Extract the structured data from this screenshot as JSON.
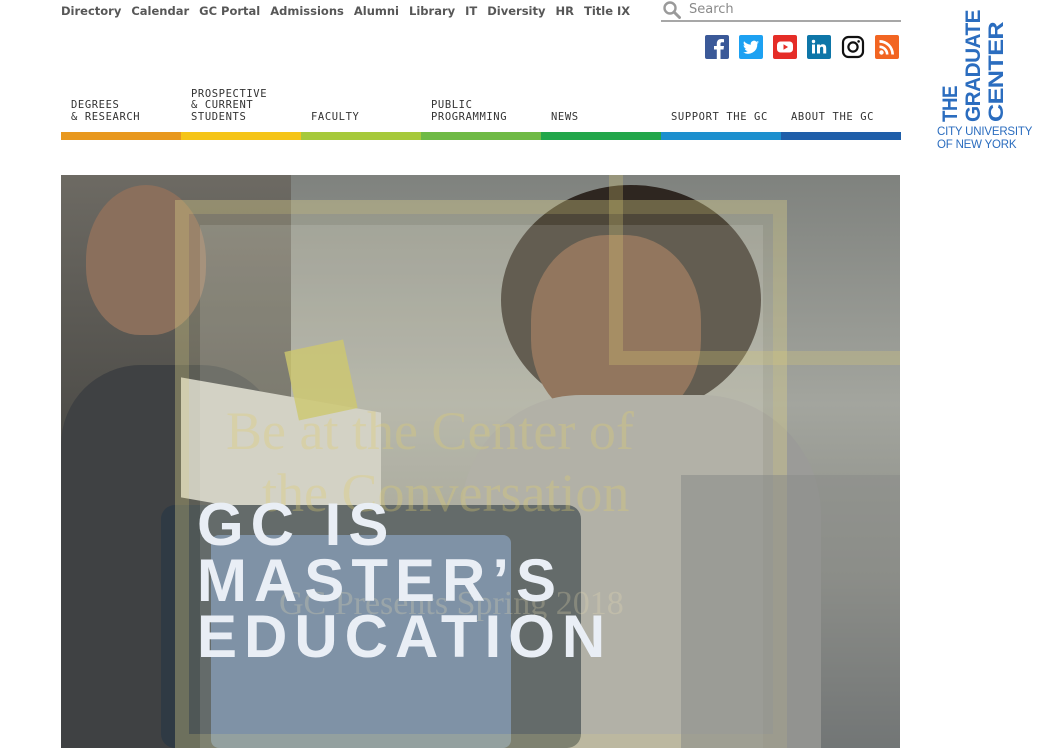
{
  "utility_nav": {
    "links": [
      "Directory",
      "Calendar",
      "GC Portal",
      "Admissions",
      "Alumni",
      "Library",
      "IT",
      "Diversity",
      "HR",
      "Title IX"
    ]
  },
  "search": {
    "placeholder": "Search"
  },
  "social": {
    "items": [
      {
        "name": "Facebook",
        "icon": "facebook-icon",
        "color": "#3b5998"
      },
      {
        "name": "Twitter",
        "icon": "twitter-icon",
        "color": "#1da1f2"
      },
      {
        "name": "YouTube",
        "icon": "youtube-icon",
        "color": "#e52d27"
      },
      {
        "name": "LinkedIn",
        "icon": "linkedin-icon",
        "color": "#0e76a8"
      },
      {
        "name": "Instagram",
        "icon": "instagram-icon",
        "color": "#111111"
      },
      {
        "name": "RSS",
        "icon": "rss-icon",
        "color": "#f26522"
      }
    ]
  },
  "logo": {
    "lines": [
      "THE",
      "GRADUATE",
      "CENTER"
    ],
    "subtitle_lines": [
      "CITY UNIVERSITY",
      "OF NEW YORK"
    ],
    "color": "#2b6dbf"
  },
  "main_nav": {
    "items": [
      {
        "label": "DEGREES\n& RESEARCH",
        "color": "#e8981e"
      },
      {
        "label": "PROSPECTIVE\n& CURRENT\nSTUDENTS",
        "color": "#f5c417"
      },
      {
        "label": "FACULTY",
        "color": "#a6c93a"
      },
      {
        "label": "PUBLIC\nPROGRAMMING",
        "color": "#6fba45"
      },
      {
        "label": "NEWS",
        "color": "#22a64a"
      },
      {
        "label": "SUPPORT THE GC",
        "color": "#1c8fce"
      },
      {
        "label": "ABOUT THE GC",
        "color": "#1f5ea9"
      }
    ]
  },
  "hero": {
    "headline_lines": [
      "GC IS",
      "MASTER’S",
      "EDUCATION"
    ],
    "background_text_lines": [
      "Be at the Center of",
      "the Conversation"
    ],
    "background_small": "GC Presents Spring 2018"
  }
}
